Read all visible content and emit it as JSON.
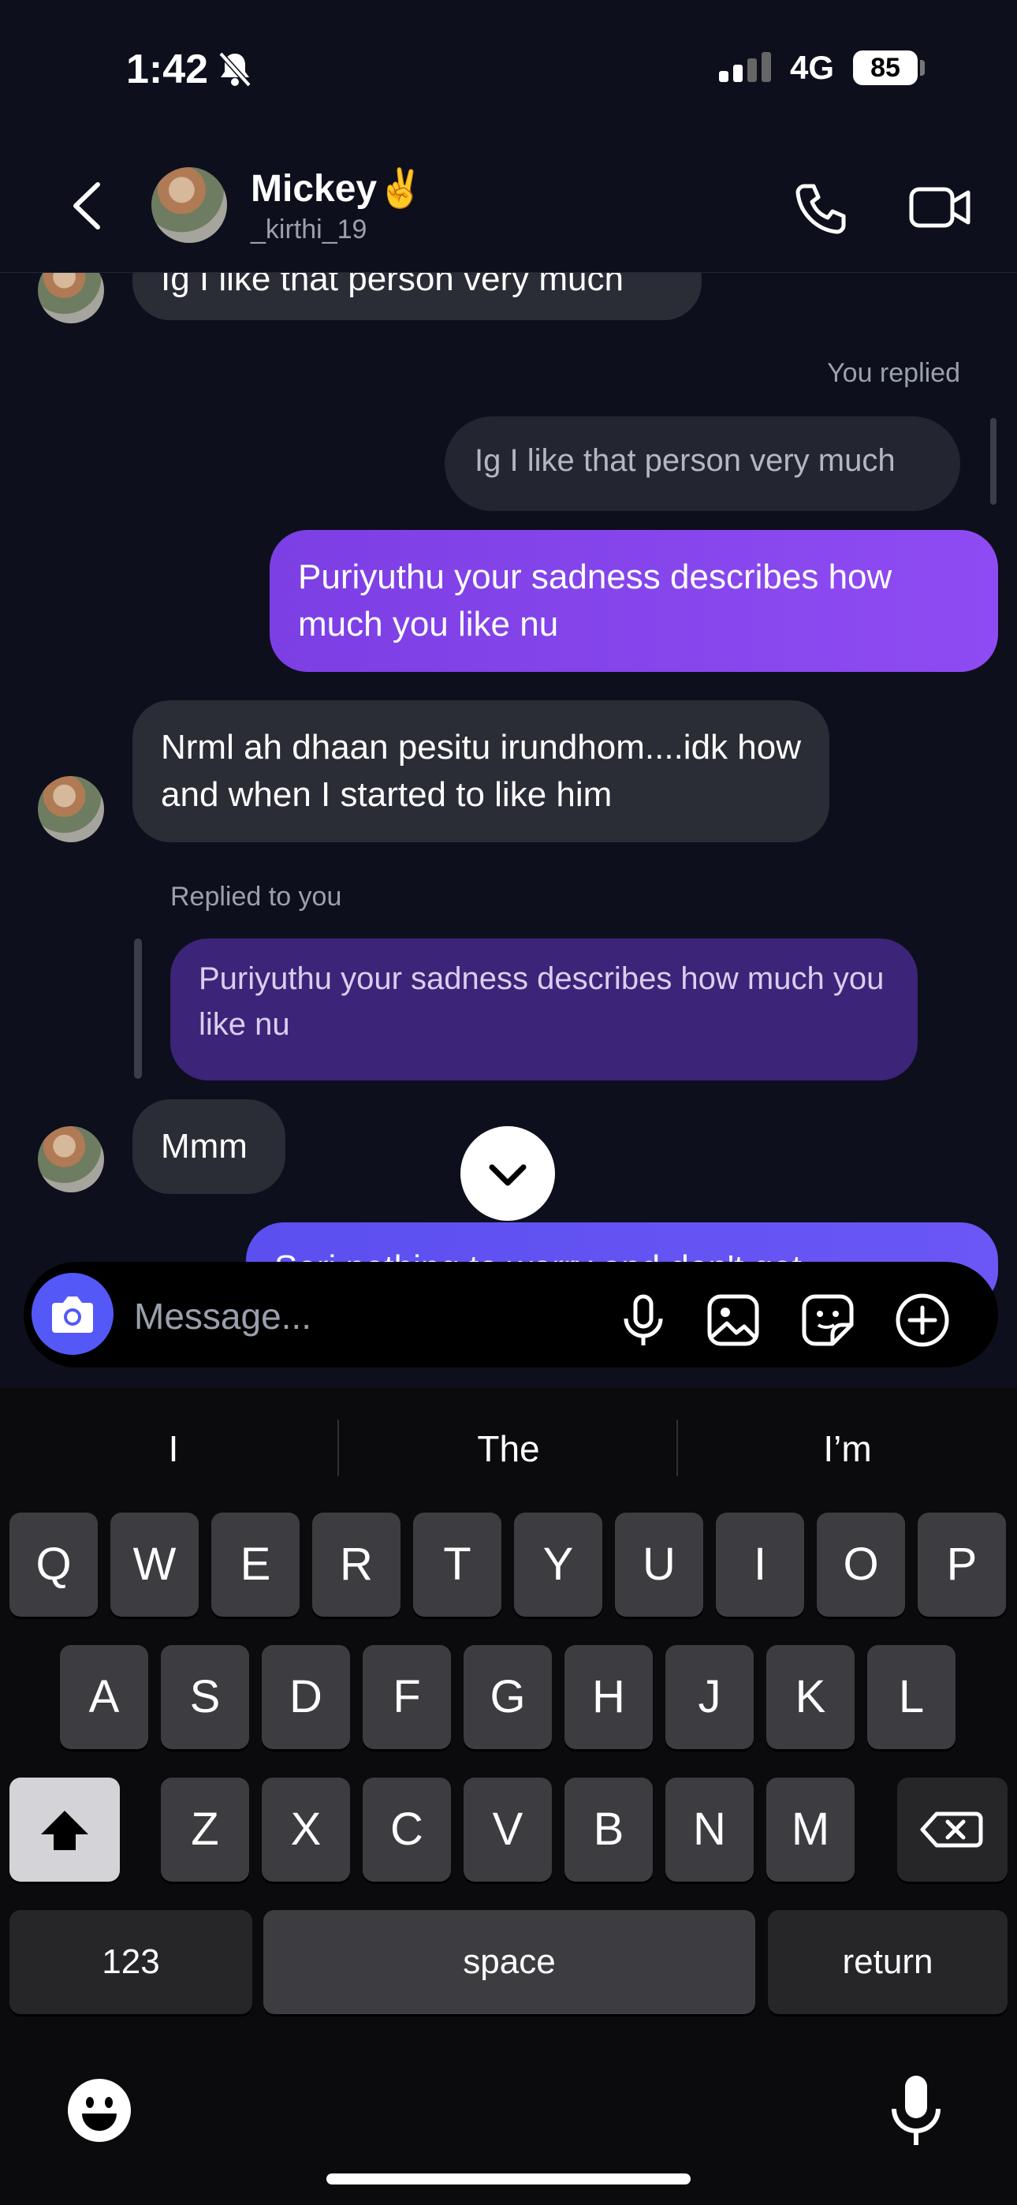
{
  "status_bar": {
    "time": "1:42",
    "network": "4G",
    "battery": "85"
  },
  "header": {
    "contact_name": "Mickey✌️",
    "username": "_kirthi_19"
  },
  "messages": {
    "top_in": "Ig I like that person very much",
    "you_replied_label": "You replied",
    "quoted_in": "Ig I like that person very much",
    "out_1": "Puriyuthu your sadness describes how much you like nu",
    "in_2": "Nrml ah dhaan pesitu irundhom....idk how and when I started to like him",
    "replied_to_you_label": "Replied to you",
    "quoted_out": "Puriyuthu your sadness describes how much you like nu",
    "in_3": "Mmm",
    "out_partial": "Seri nothing to worry and don't get"
  },
  "composer": {
    "placeholder": "Message..."
  },
  "keyboard": {
    "suggestions": [
      "I",
      "The",
      "I’m"
    ],
    "row1": [
      "Q",
      "W",
      "E",
      "R",
      "T",
      "Y",
      "U",
      "I",
      "O",
      "P"
    ],
    "row2": [
      "A",
      "S",
      "D",
      "F",
      "G",
      "H",
      "J",
      "K",
      "L"
    ],
    "row3": [
      "Z",
      "X",
      "C",
      "V",
      "B",
      "N",
      "M"
    ],
    "numbers_label": "123",
    "space_label": "space",
    "return_label": "return"
  },
  "colors": {
    "background": "#0d0f1c",
    "outgoing": "#8b47f0",
    "incoming": "#2a2c36",
    "camera": "#5458f7"
  }
}
